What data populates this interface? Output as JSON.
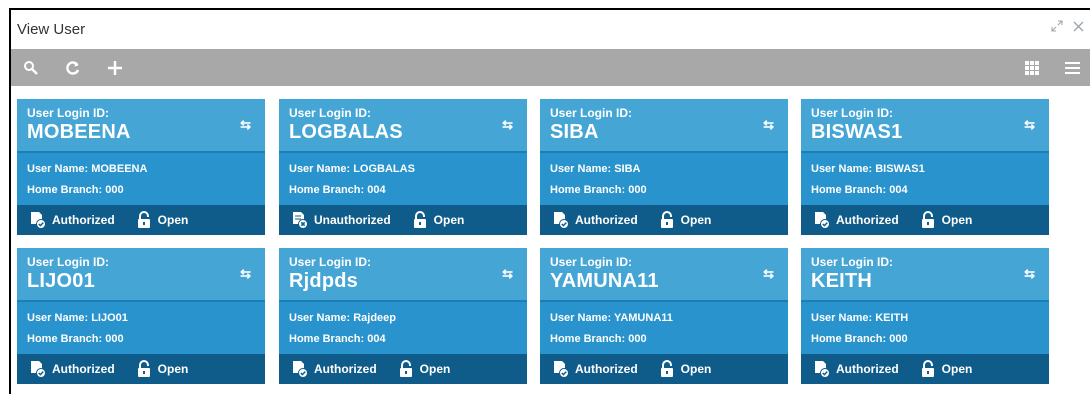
{
  "window": {
    "title": "View User",
    "controls": [
      {
        "name": "minimize-icon",
        "glyph": "⤡"
      },
      {
        "name": "close-icon",
        "glyph": "✕"
      }
    ]
  },
  "toolbar": {
    "left": [
      "search-icon",
      "refresh-icon",
      "add-icon"
    ],
    "right": [
      "tile-view-icon",
      "list-view-icon"
    ]
  },
  "card_labels": {
    "login_id": "User Login ID:",
    "user_name": "User Name:",
    "home_branch": "Home Branch:"
  },
  "cards": [
    {
      "login_id": "MOBEENA",
      "user_name": "MOBEENA",
      "home_branch": "000",
      "auth": "Authorized",
      "lock": "Open"
    },
    {
      "login_id": "LOGBALAS",
      "user_name": "LOGBALAS",
      "home_branch": "004",
      "auth": "Unauthorized",
      "lock": "Open"
    },
    {
      "login_id": "SIBA",
      "user_name": "SIBA",
      "home_branch": "000",
      "auth": "Authorized",
      "lock": "Open"
    },
    {
      "login_id": "BISWAS1",
      "user_name": "BISWAS1",
      "home_branch": "004",
      "auth": "Authorized",
      "lock": "Open"
    },
    {
      "login_id": "LIJO01",
      "user_name": "LIJO01",
      "home_branch": "000",
      "auth": "Authorized",
      "lock": "Open"
    },
    {
      "login_id": "Rjdpds",
      "user_name": "Rajdeep",
      "home_branch": "004",
      "auth": "Authorized",
      "lock": "Open"
    },
    {
      "login_id": "YAMUNA11",
      "user_name": "YAMUNA11",
      "home_branch": "000",
      "auth": "Authorized",
      "lock": "Open"
    },
    {
      "login_id": "KEITH",
      "user_name": "KEITH",
      "home_branch": "000",
      "auth": "Authorized",
      "lock": "Open"
    }
  ],
  "colors": {
    "card_header": "#45a6d6",
    "card_body": "#2893cc",
    "card_footer": "#0f5c8a",
    "toolbar": "#a8a8a8"
  }
}
